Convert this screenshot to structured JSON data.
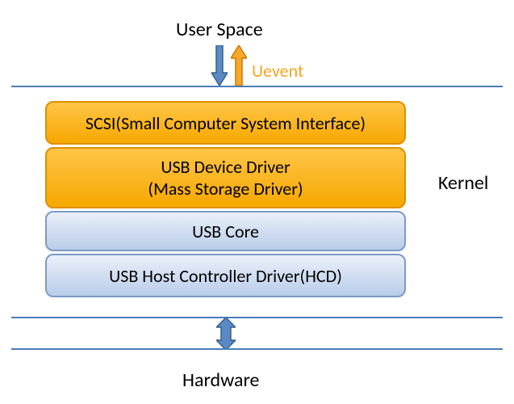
{
  "labels": {
    "top": "User Space",
    "uevent": "Uevent",
    "kernel": "Kernel",
    "bottom": "Hardware"
  },
  "layers": {
    "scsi": "SCSI(Small Computer System Interface)",
    "driver_line1": "USB Device Driver",
    "driver_line2": "(Mass Storage Driver)",
    "core": "USB Core",
    "hcd": "USB Host Controller Driver(HCD)"
  },
  "colors": {
    "orange": "#f6a800",
    "blue": "#4a7ebb"
  }
}
